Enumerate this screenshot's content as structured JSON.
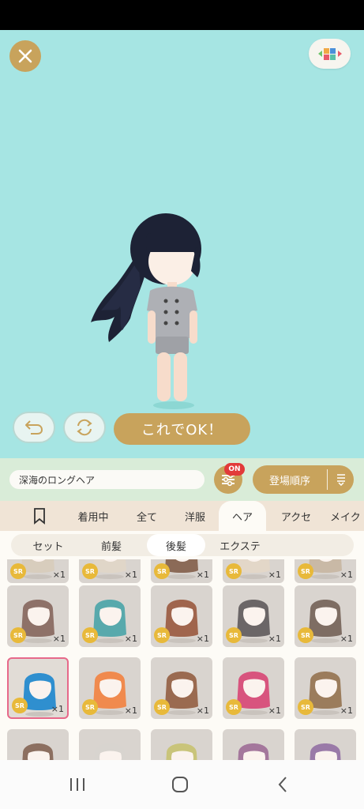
{
  "stage": {
    "bg_color": "#a6e5e3",
    "ok_label": "これでOK！"
  },
  "toolbar": {
    "item_name": "深海のロングヘア",
    "filter_badge": "ON",
    "sort_label": "登場順序"
  },
  "tabs": [
    {
      "label": "着用中"
    },
    {
      "label": "全て"
    },
    {
      "label": "洋服"
    },
    {
      "label": "ヘア"
    },
    {
      "label": "アクセ"
    },
    {
      "label": "メイク"
    }
  ],
  "subtabs": [
    {
      "label": "セット"
    },
    {
      "label": "前髪"
    },
    {
      "label": "後髪"
    },
    {
      "label": "エクステ"
    }
  ],
  "grid": {
    "rarity": "SR",
    "quantity": "×1",
    "rows": [
      {
        "items": [
          {
            "hair": "#d8cdbd"
          },
          {
            "hair": "#e0d6c8"
          },
          {
            "hair": "#8b6a57"
          },
          {
            "hair": "#e3d7c8"
          },
          {
            "hair": "#c9b9a6"
          }
        ]
      },
      {
        "items": [
          {
            "hair": "#8e7168"
          },
          {
            "hair": "#58a9ac"
          },
          {
            "hair": "#a0654d"
          },
          {
            "hair": "#6b6667"
          },
          {
            "hair": "#7e6d63"
          }
        ]
      },
      {
        "items": [
          {
            "hair": "#2f8fcf",
            "selected": true
          },
          {
            "hair": "#f08a4e"
          },
          {
            "hair": "#9a6a50"
          },
          {
            "hair": "#d8547e"
          },
          {
            "hair": "#9b7c5c"
          }
        ]
      },
      {
        "items": [
          {
            "hair": "#8c6f60"
          },
          {
            "hair": "#d8d4cf"
          },
          {
            "hair": "#c9c47a"
          },
          {
            "hair": "#a4779c"
          },
          {
            "hair": "#9a7aa8"
          }
        ]
      }
    ]
  },
  "colors": {
    "accent": "#c8a35c",
    "toolbar_bg": "#d9ecd8",
    "tab_bg": "#f0e4d6",
    "selected_border": "#e7698a",
    "sr_badge": "#e8b93a"
  }
}
